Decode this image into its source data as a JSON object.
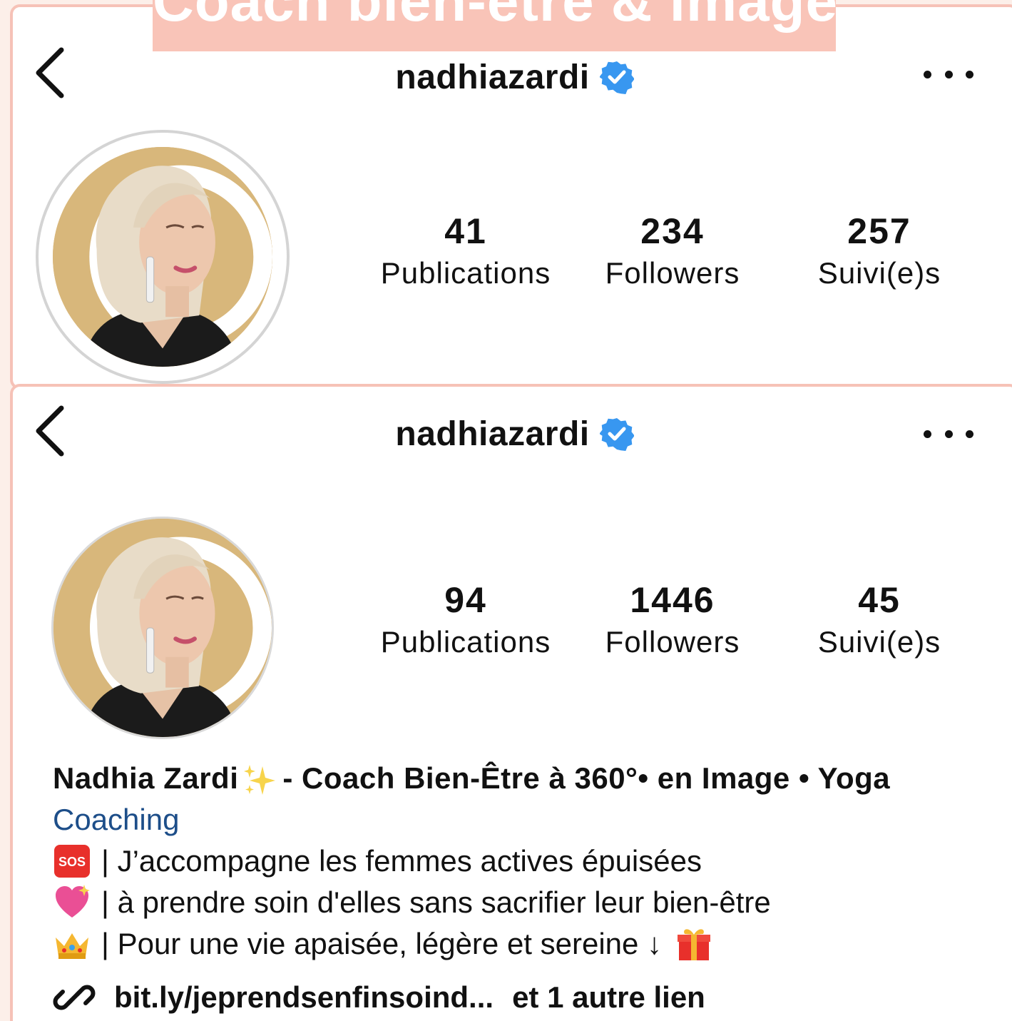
{
  "banner": {
    "text": "Coach bien-être & image"
  },
  "profiles": [
    {
      "username": "nadhiazardi",
      "stats": [
        {
          "value": "41",
          "label": "Publications"
        },
        {
          "value": "234",
          "label": "Followers"
        },
        {
          "value": "257",
          "label": "Suivi(e)s"
        }
      ]
    },
    {
      "username": "nadhiazardi",
      "stats": [
        {
          "value": "94",
          "label": "Publications"
        },
        {
          "value": "1446",
          "label": "Followers"
        },
        {
          "value": "45",
          "label": "Suivi(e)s"
        }
      ],
      "bio": {
        "name": "Nadhia Zardi",
        "headline": "- Coach Bien-Être à 360°• en Image • Yoga",
        "category": "Coaching",
        "lines": [
          {
            "icon": "sos-icon",
            "text": "| J’accompagne les femmes actives épuisées"
          },
          {
            "icon": "sparkling-heart-icon",
            "text": "| à prendre soin d'elles sans sacrifier leur bien-être"
          },
          {
            "icon": "crown-icon",
            "text": "| Pour une vie apaisée, légère et sereine ↓"
          }
        ],
        "trailing_icon": "gift-icon",
        "link": "bit.ly/jeprendsenfinsoind...",
        "more_links": "et 1 autre lien"
      }
    }
  ],
  "colors": {
    "accent_border": "#f6c2b7",
    "banner_bg": "#f9c4b8",
    "verified_blue": "#3897f0",
    "category_link": "#1d4e89",
    "avatar_gold": "#d8b77b"
  }
}
